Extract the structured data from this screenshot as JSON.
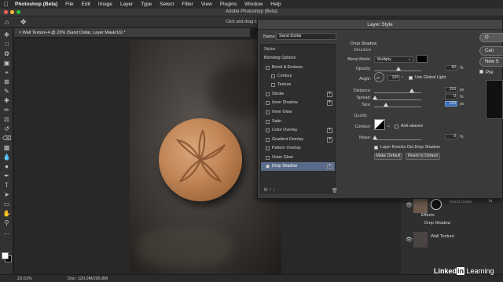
{
  "menubar": {
    "app_name": "Photoshop (Beta)",
    "items": [
      "File",
      "Edit",
      "Image",
      "Layer",
      "Type",
      "Select",
      "Filter",
      "View",
      "Plugins",
      "Window",
      "Help"
    ]
  },
  "titlebar": {
    "title": "Adobe Photoshop (Beta)"
  },
  "optionsbar": {
    "hint": "Click and drag to m"
  },
  "document": {
    "tab_label": "× Wall Texture-4 @ 23% (Sand Dollar, Layer Mask/16) *"
  },
  "statusbar": {
    "zoom": "23.01%",
    "doc_size": "Doc: 120.0M/295.8M"
  },
  "dialog": {
    "title": "Layer Style",
    "name_label": "Name:",
    "name_value": "Sand Dollar",
    "styles_header": "Styles",
    "styles": [
      {
        "label": "Blending Options",
        "checkbox": false,
        "plus": false,
        "selected": false
      },
      {
        "label": "Bevel & Emboss",
        "checkbox": true,
        "plus": false,
        "selected": false
      },
      {
        "label": "Contour",
        "checkbox": true,
        "plus": false,
        "selected": false,
        "indent": true
      },
      {
        "label": "Texture",
        "checkbox": true,
        "plus": false,
        "selected": false,
        "indent": true
      },
      {
        "label": "Stroke",
        "checkbox": true,
        "plus": true,
        "selected": false
      },
      {
        "label": "Inner Shadow",
        "checkbox": true,
        "plus": true,
        "selected": false
      },
      {
        "label": "Inner Glow",
        "checkbox": true,
        "plus": false,
        "selected": false
      },
      {
        "label": "Satin",
        "checkbox": true,
        "plus": false,
        "selected": false
      },
      {
        "label": "Color Overlay",
        "checkbox": true,
        "plus": true,
        "selected": false
      },
      {
        "label": "Gradient Overlay",
        "checkbox": true,
        "plus": true,
        "selected": false
      },
      {
        "label": "Pattern Overlay",
        "checkbox": true,
        "plus": false,
        "selected": false
      },
      {
        "label": "Outer Glow",
        "checkbox": true,
        "plus": false,
        "selected": false
      },
      {
        "label": "Drop Shadow",
        "checkbox": true,
        "plus": true,
        "selected": true
      }
    ],
    "drop_shadow": {
      "section_title": "Drop Shadow",
      "subsection": "Structure",
      "blend_mode_label": "Blend Mode:",
      "blend_mode": "Multiply",
      "opacity_label": "Opacity:",
      "opacity": "50",
      "angle_label": "Angle:",
      "angle": "109",
      "use_global_light": "Use Global Light",
      "distance_label": "Distance:",
      "distance": "153",
      "spread_label": "Spread:",
      "spread": "0",
      "size_label": "Size:",
      "size": "120",
      "unit_percent": "%",
      "unit_px": "px",
      "unit_deg": "°",
      "quality_title": "Quality",
      "contour_label": "Contour:",
      "anti_aliased": "Anti-aliased",
      "noise_label": "Noise:",
      "noise": "0",
      "knockout": "Layer Knocks Out Drop Shadow",
      "make_default": "Make Default",
      "reset_default": "Reset to Default"
    },
    "side_buttons": [
      "O",
      "Can",
      "New S",
      "Pre"
    ],
    "fx_label": "fx"
  },
  "layers": {
    "sand_dollar_label": "Sand Dollar",
    "effects_label": "Effects",
    "drop_shadow_label": "Drop Shadow",
    "wall_texture_label": "Wall Texture"
  },
  "watermark": {
    "brand": "Linked",
    "brand2": "in",
    "learning": " Learning"
  },
  "colors": {
    "accent_blue": "#3e6fb6",
    "selected_row": "#5a6a8a"
  }
}
